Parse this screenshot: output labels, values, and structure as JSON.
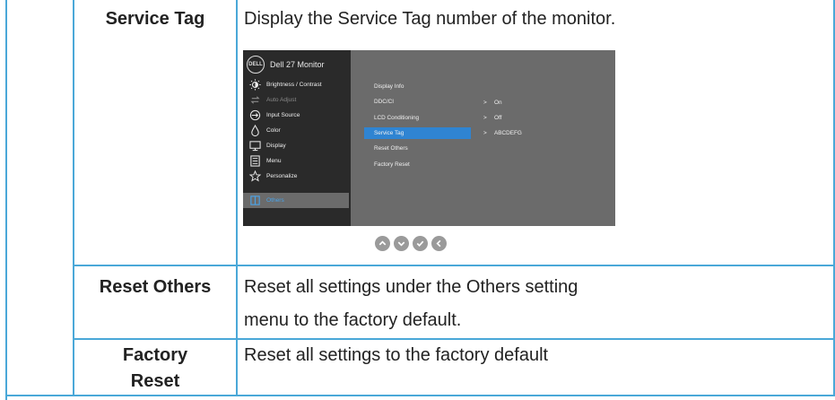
{
  "rows": [
    {
      "label": "Service Tag",
      "desc": "Display the Service Tag number of the monitor."
    },
    {
      "label": "Reset Others",
      "desc_line1": "Reset all settings under the Others setting",
      "desc_line2": "menu to the factory default."
    },
    {
      "label_line1": "Factory",
      "label_line2": "Reset",
      "desc": "Reset all settings to the factory default"
    }
  ],
  "osd": {
    "logo": "DELL",
    "title": "Dell 27 Monitor",
    "menu": [
      {
        "label": "Brightness / Contrast",
        "icon": "brightness-icon",
        "state": "normal"
      },
      {
        "label": "Auto Adjust",
        "icon": "auto-adjust-icon",
        "state": "dim"
      },
      {
        "label": "Input Source",
        "icon": "input-source-icon",
        "state": "normal"
      },
      {
        "label": "Color",
        "icon": "color-icon",
        "state": "normal"
      },
      {
        "label": "Display",
        "icon": "display-icon",
        "state": "normal"
      },
      {
        "label": "Menu",
        "icon": "menu-icon",
        "state": "normal"
      },
      {
        "label": "Personalize",
        "icon": "star-icon",
        "state": "normal"
      },
      {
        "label": "Others",
        "icon": "others-icon",
        "state": "selected"
      }
    ],
    "submenu": [
      "Display Info",
      "DDC/CI",
      "LCD Conditioning",
      "Service Tag",
      "Reset Others",
      "Factory Reset"
    ],
    "values": {
      "ddc": "On",
      "lcd": "Off",
      "service_tag": "ABCDEFG"
    },
    "selected_submenu": "Service Tag",
    "selected_color": "#2f84d2",
    "nav_buttons": [
      "up-icon",
      "down-icon",
      "check-icon",
      "back-icon"
    ]
  },
  "colors": {
    "border": "#4aa8d8",
    "osd_bg": "#2e2e2e",
    "osd_panel": "#6b6b6b",
    "highlight": "#4aa3e8"
  }
}
